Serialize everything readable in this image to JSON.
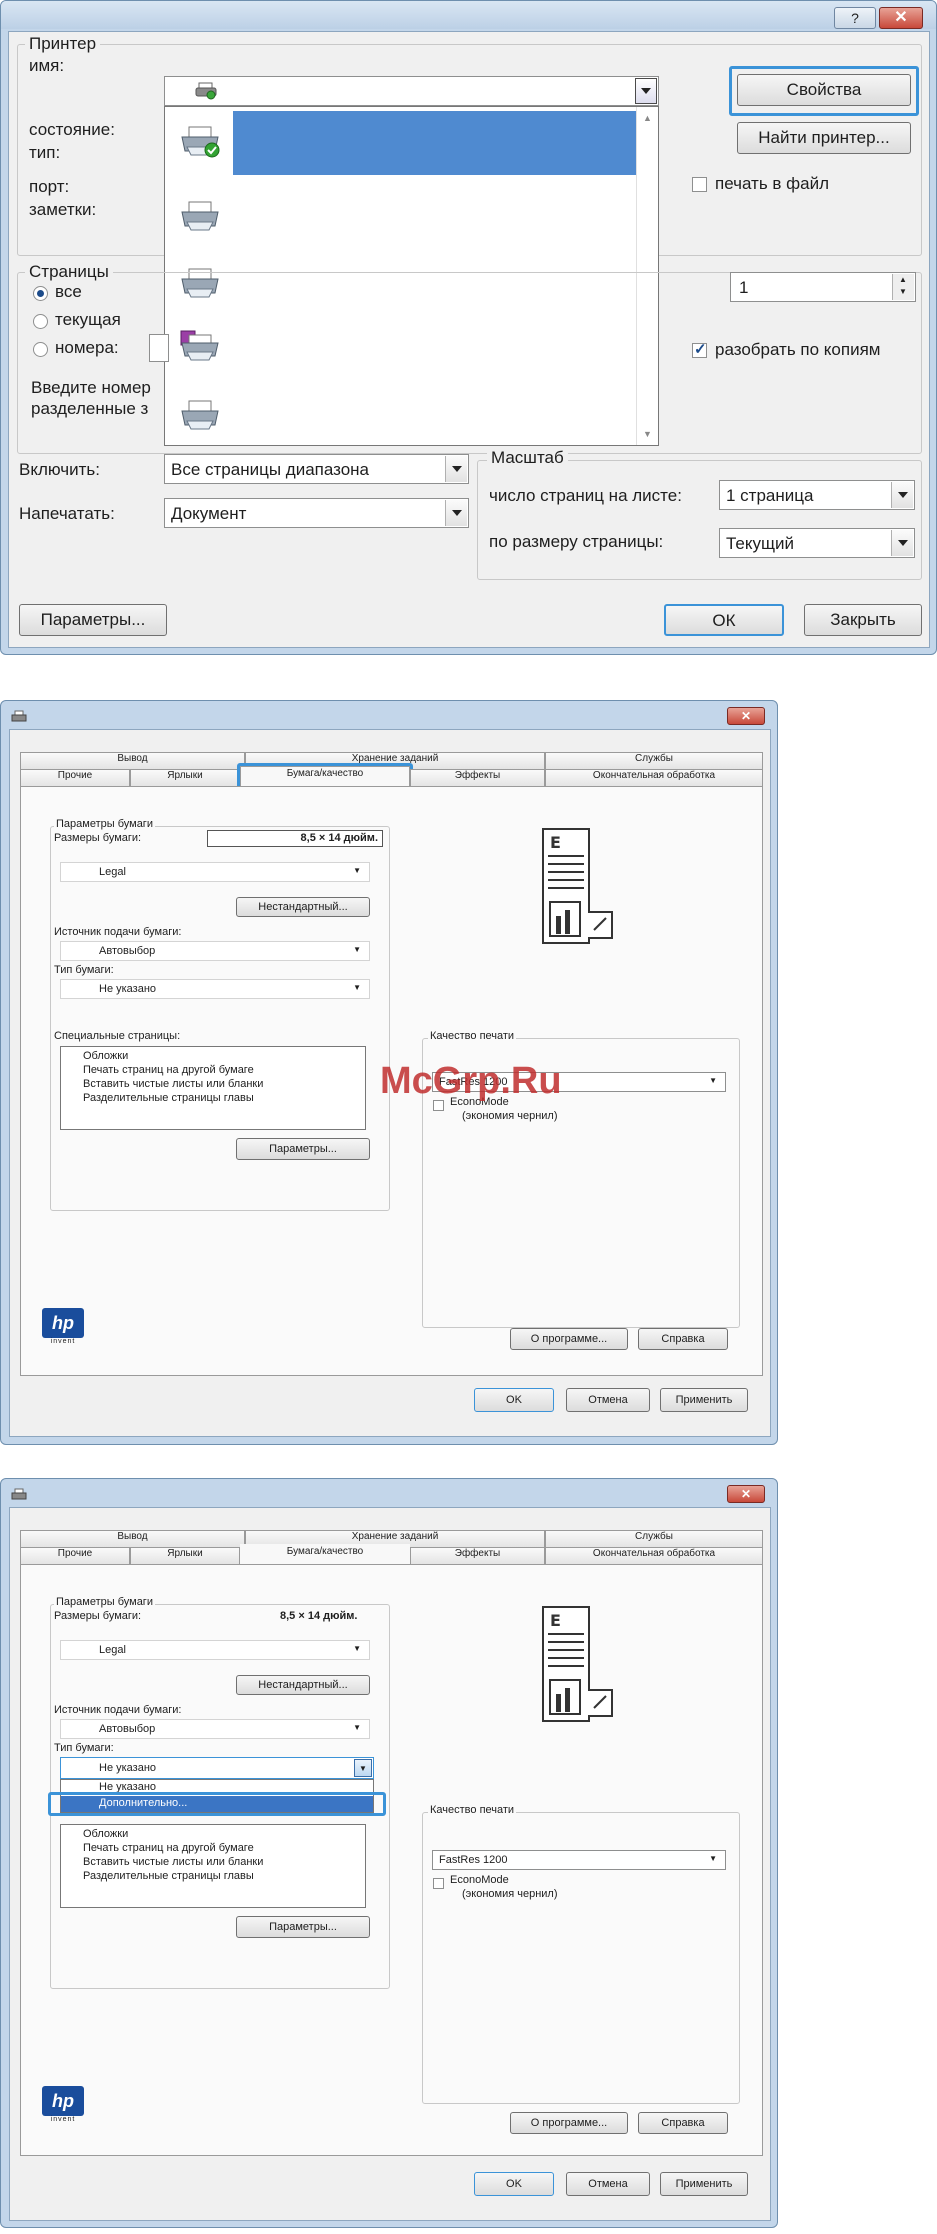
{
  "dialog1": {
    "help_button": "?",
    "printer_group": "Принтер",
    "name_label": "имя:",
    "status_label": "состояние:",
    "type_label": "тип:",
    "port_label": "порт:",
    "notes_label": "заметки:",
    "properties_button": "Свойства",
    "find_printer_button": "Найти принтер...",
    "print_to_file": "печать в файл",
    "pages_group": "Страницы",
    "all_label": "все",
    "current_label": "текущая",
    "numbers_label": "номера:",
    "hint_line1": "Введите номер",
    "hint_line2": "разделенные з",
    "copies_value": "1",
    "collate_label": "разобрать по копиям",
    "include_label": "Включить:",
    "include_value": "Все страницы диапазона",
    "print_label": "Напечатать:",
    "print_value": "Документ",
    "scale_group": "Масштаб",
    "pages_per_sheet_label": "число страниц на листе:",
    "pages_per_sheet_value": "1 страница",
    "fit_label": "по размеру страницы:",
    "fit_value": "Текущий",
    "options_button": "Параметры...",
    "ok_button": "ОК",
    "close_button": "Закрыть"
  },
  "tabs": {
    "row1": [
      "Вывод",
      "Хранение заданий",
      "Службы"
    ],
    "row2": [
      "Прочие",
      "Ярлыки",
      "Бумага/качество",
      "Эффекты",
      "Окончательная обработка"
    ]
  },
  "paper": {
    "group": "Параметры бумаги",
    "size_label": "Размеры бумаги:",
    "size_value": "8,5 × 14 дюйм.",
    "size_select": "Legal",
    "custom_button": "Нестандартный...",
    "source_label": "Источник подачи бумаги:",
    "source_value": "Автовыбор",
    "type_label": "Тип бумаги:",
    "type_value": "Не указано",
    "special_label": "Специальные страницы:",
    "special_items": [
      "Обложки",
      "Печать страниц на другой бумаге",
      "Вставить чистые листы или бланки",
      "Разделительные страницы главы"
    ],
    "params_button": "Параметры...",
    "quality_group": "Качество печати",
    "quality_value": "FastRes 1200",
    "econo_line1": "EconoMode",
    "econo_line2": "(экономия чернил)",
    "about_button": "О программе...",
    "help_button": "Справка",
    "ok_button": "OK",
    "cancel_button": "Отмена",
    "apply_button": "Применить",
    "dropdown_items": [
      "Не указано",
      "Дополнительно..."
    ]
  },
  "watermark": "McGrp.Ru",
  "logo": "hp",
  "logo_sub": "invent"
}
